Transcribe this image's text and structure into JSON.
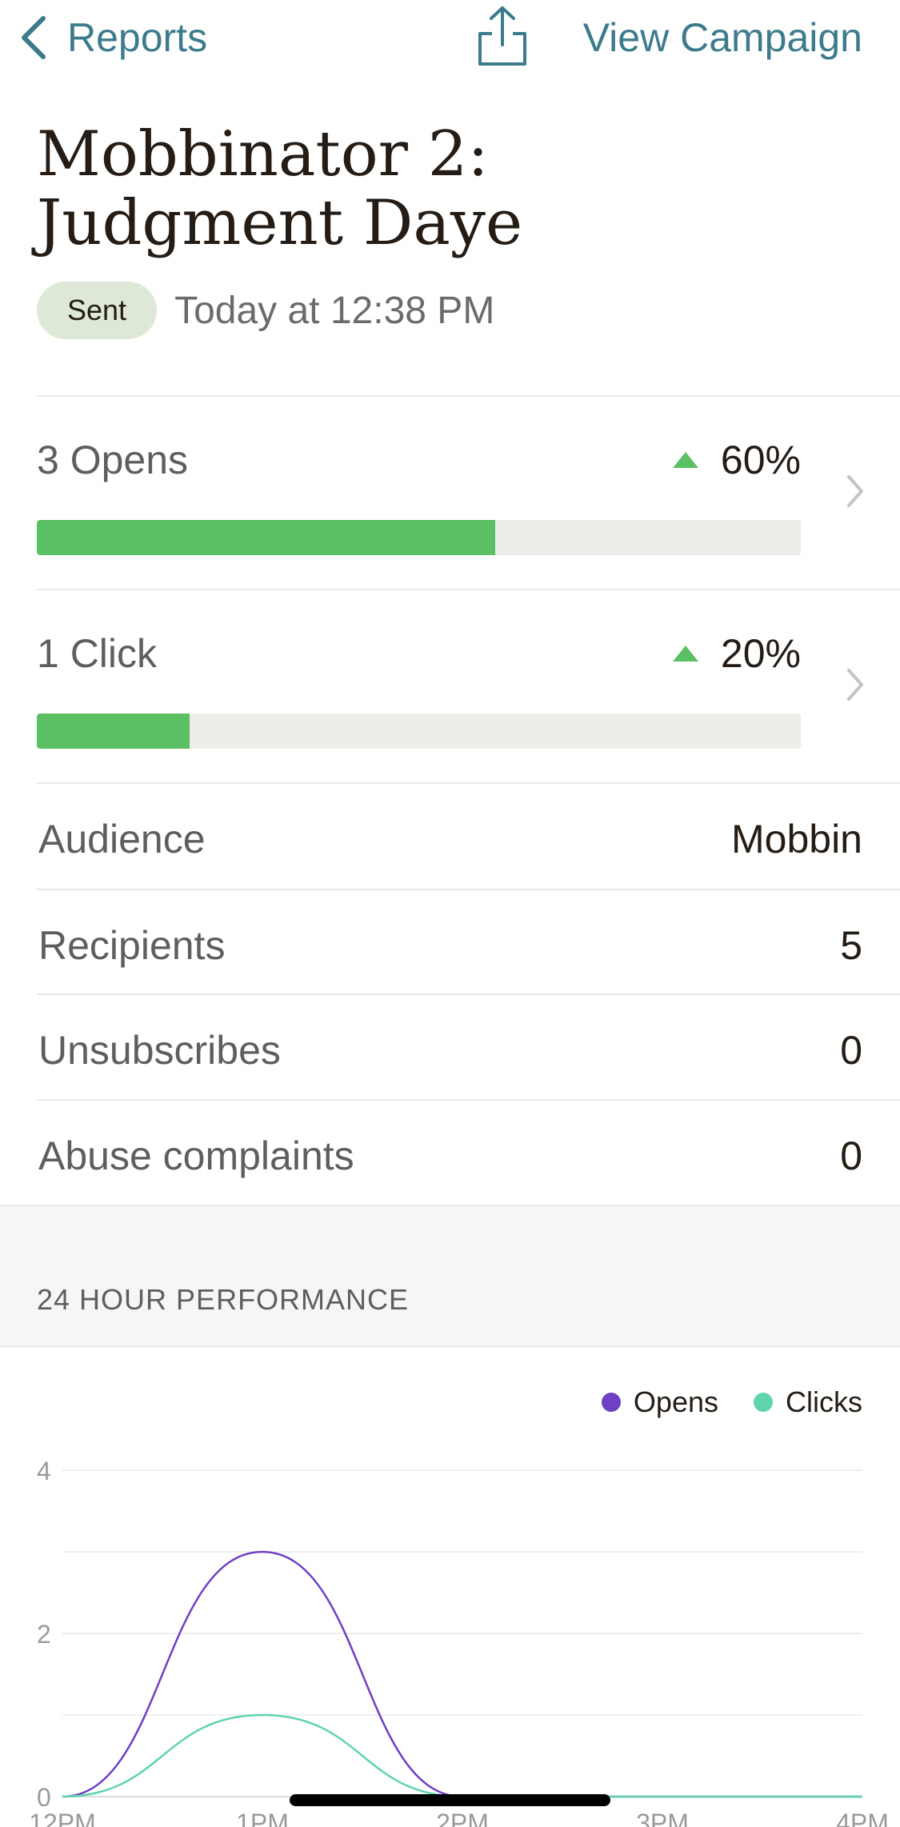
{
  "nav": {
    "back_label": "Reports",
    "view_label": "View Campaign"
  },
  "campaign": {
    "title_line1": "Mobbinator 2:",
    "title_line2": "Judgment Daye",
    "status": "Sent",
    "sent_time": "Today at 12:38 PM"
  },
  "metrics": [
    {
      "label": "3 Opens",
      "rate": "60%",
      "fraction": 0.6
    },
    {
      "label": "1 Click",
      "rate": "20%",
      "fraction": 0.2
    }
  ],
  "details": [
    {
      "label": "Audience",
      "value": "Mobbin"
    },
    {
      "label": "Recipients",
      "value": "5"
    },
    {
      "label": "Unsubscribes",
      "value": "0"
    },
    {
      "label": "Abuse complaints",
      "value": "0"
    }
  ],
  "section": {
    "title": "24 HOUR PERFORMANCE"
  },
  "colors": {
    "accent": "#3d7b8c",
    "progress": "#5bbf63",
    "opens": "#6f3fc4",
    "clicks": "#5fd3ac"
  },
  "chart_data": {
    "type": "line",
    "x": [
      "12PM",
      "1PM",
      "2PM",
      "3PM",
      "4PM"
    ],
    "ylim": [
      0,
      4
    ],
    "yticks": [
      0,
      2,
      4
    ],
    "legend": "top-right",
    "series": [
      {
        "name": "Opens",
        "values": [
          0,
          3,
          0,
          0,
          0
        ]
      },
      {
        "name": "Clicks",
        "values": [
          0,
          1,
          0,
          0,
          0
        ]
      }
    ]
  }
}
